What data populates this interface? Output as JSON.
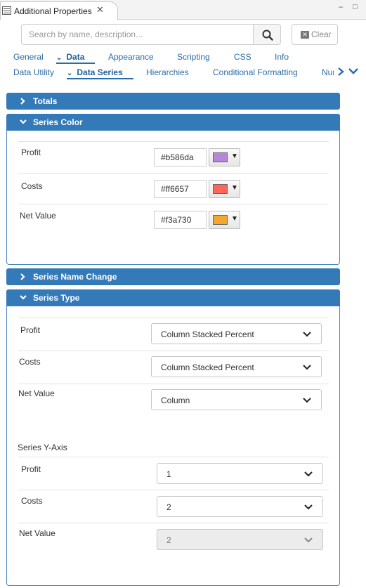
{
  "view": {
    "title": "Additional Properties",
    "close": "✕",
    "minimize": "–",
    "maximize": "□"
  },
  "search": {
    "placeholder": "Search by name, description...",
    "value": "",
    "clear_label": "Clear"
  },
  "tabs_row1": [
    {
      "label": "General"
    },
    {
      "label": "Data",
      "active": true
    },
    {
      "label": "Appearance"
    },
    {
      "label": "Scripting"
    },
    {
      "label": "CSS"
    },
    {
      "label": "Info"
    }
  ],
  "tabs_row2": [
    {
      "label": "Data Utility"
    },
    {
      "label": "Data Series",
      "active": true
    },
    {
      "label": "Hierarchies"
    },
    {
      "label": "Conditional Formatting"
    },
    {
      "label": "Nur"
    }
  ],
  "panels": {
    "totals": {
      "title": "Totals",
      "expanded": false
    },
    "series_color": {
      "title": "Series Color",
      "expanded": true,
      "rows": [
        {
          "label": "Profit",
          "hex": "#b586da",
          "color": "#b586da"
        },
        {
          "label": "Costs",
          "hex": "#ff6657",
          "color": "#ff6657"
        },
        {
          "label": "Net Value",
          "hex": "#f3a730",
          "color": "#f3a730"
        }
      ],
      "dropdown_glyph": "▼"
    },
    "series_name_change": {
      "title": "Series Name Change",
      "expanded": false
    },
    "series_type": {
      "title": "Series Type",
      "expanded": true,
      "rows": [
        {
          "label": "Profit",
          "value": "Column Stacked Percent"
        },
        {
          "label": "Costs",
          "value": "Column Stacked Percent"
        },
        {
          "label": "Net Value",
          "value": "Column"
        }
      ],
      "y_axis_label": "Series Y-Axis",
      "y_axis_rows": [
        {
          "label": "Profit",
          "value": "1",
          "disabled": false
        },
        {
          "label": "Costs",
          "value": "2",
          "disabled": false
        },
        {
          "label": "Net Value",
          "value": "2",
          "disabled": true
        }
      ]
    }
  },
  "colors": {
    "panel_header": "#347ab8",
    "tab_link": "#2a6ca8"
  }
}
